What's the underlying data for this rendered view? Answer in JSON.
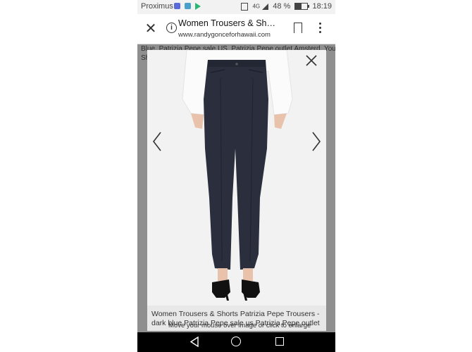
{
  "status_bar": {
    "carrier": "Proximus",
    "signal_type": "4G",
    "battery_percent_text": "48 %",
    "battery_level": 0.48,
    "time": "18:19",
    "notification_icons": [
      "app-icon-blue",
      "app-icon-teal",
      "play-store-icon"
    ]
  },
  "toolbar": {
    "page_title": "Women Trousers & Shorts Patrizia Pepe Trousers - dark blue Patrizia Pepe sale us Patrizia Pepe outlet",
    "url": "www.randygonceforhawaii.com",
    "close_icon": "close-icon",
    "info_icon": "info-icon",
    "bookmark_icon": "bookmark-icon",
    "menu_icon": "more-vert-icon"
  },
  "background_page": {
    "text_line_1": "Blue, Patrizia Pepe sale US, Patrizia Pepe outlet Amsterd, You",
    "text_line_2": "Sh"
  },
  "lightbox": {
    "caption": "Women Trousers & Shorts Patrizia Pepe Trousers - dark blue Patrizia Pepe sale us Patrizia Pepe outlet",
    "hint": "Move your mouse over image or click to enlarge",
    "colors": {
      "trousers": "#2a2e3d",
      "shirt": "#fbfbfb",
      "shoes": "#111111",
      "skin": "#e8c2ab",
      "backdrop": "#f2f2f2"
    }
  },
  "nav_bar": {
    "back_icon": "back-triangle-icon",
    "home_icon": "home-circle-icon",
    "recent_icon": "recent-square-icon"
  }
}
